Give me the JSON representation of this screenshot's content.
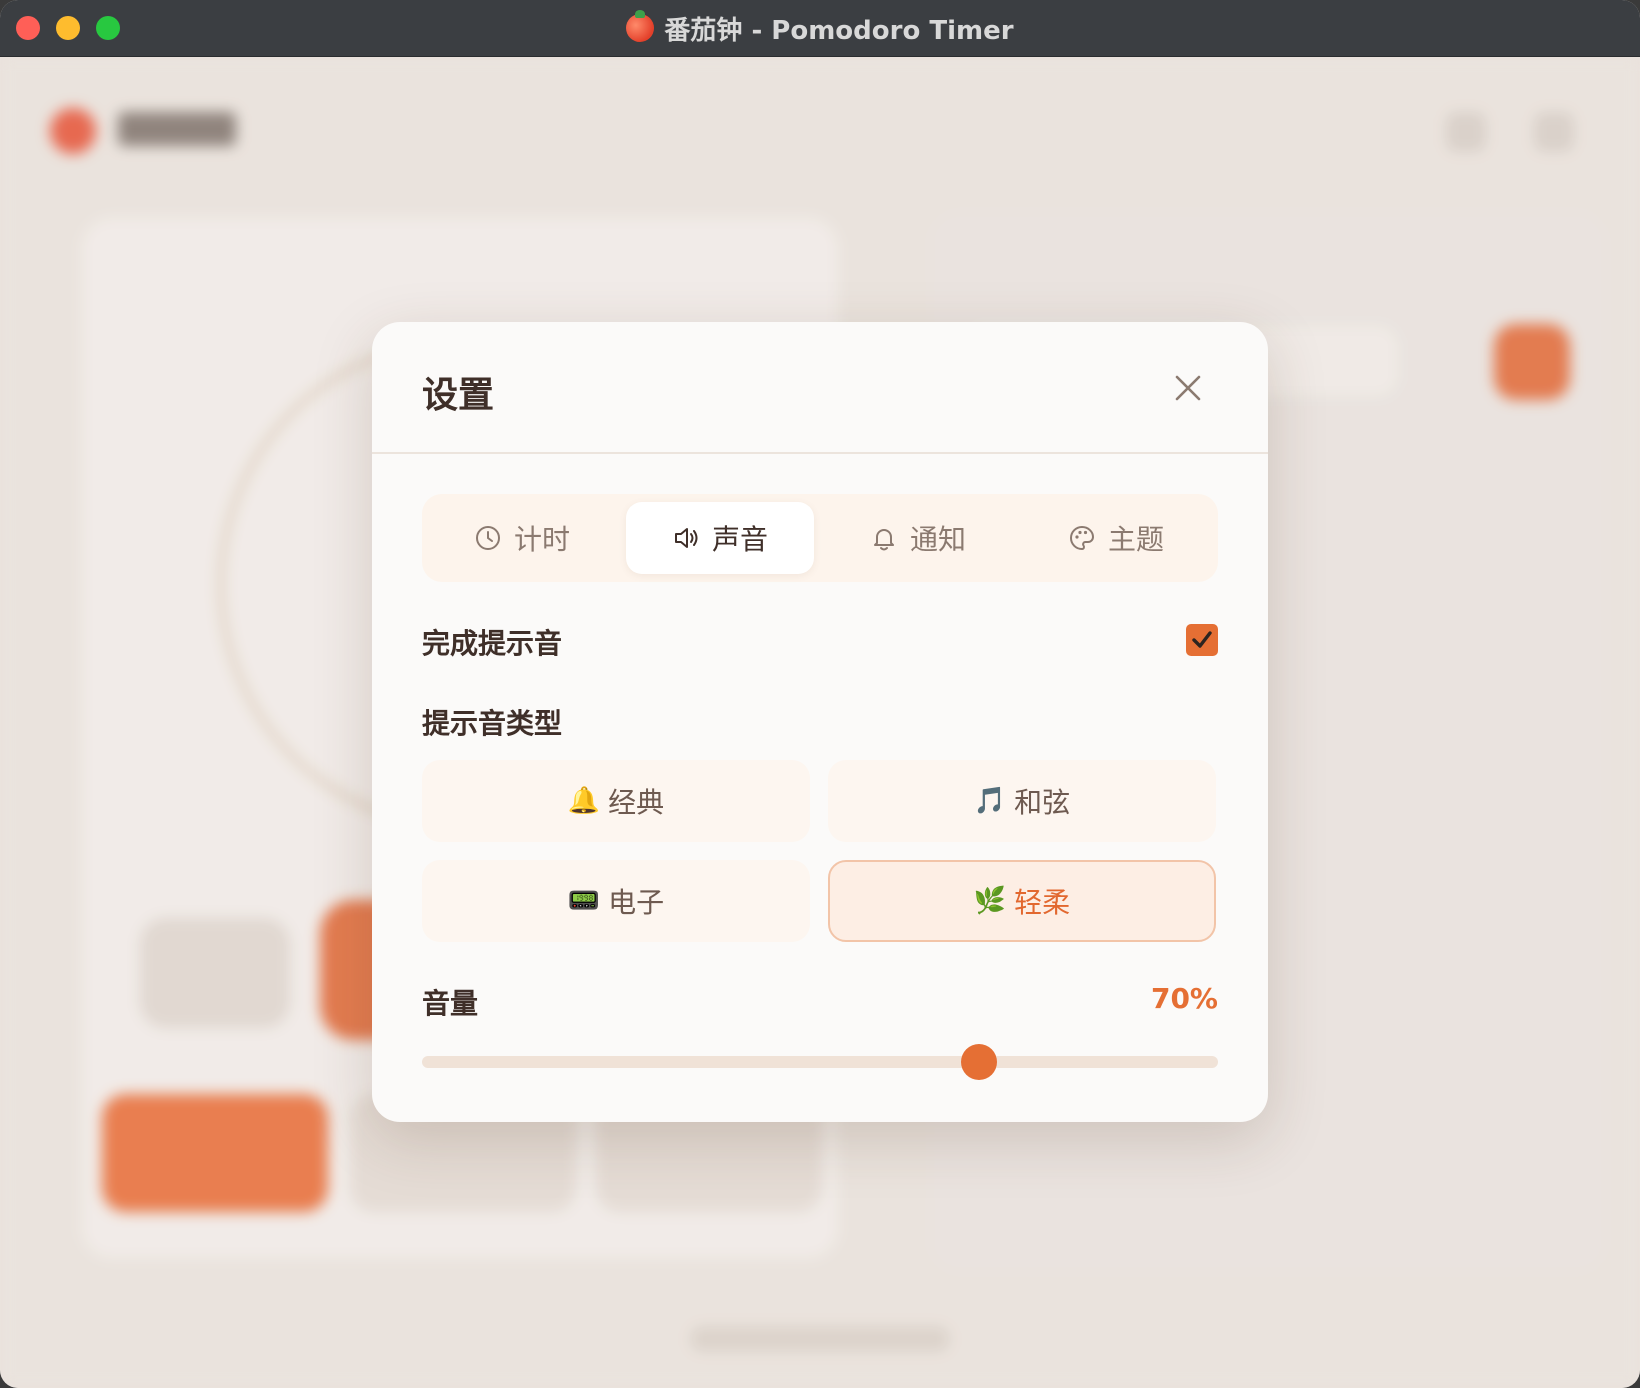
{
  "window": {
    "title": "番茄钟 - Pomodoro Timer"
  },
  "modal": {
    "title": "设置",
    "tabs": [
      {
        "label": "计时",
        "icon": "clock-icon",
        "active": false
      },
      {
        "label": "声音",
        "icon": "speaker-icon",
        "active": true
      },
      {
        "label": "通知",
        "icon": "bell-icon",
        "active": false
      },
      {
        "label": "主题",
        "icon": "palette-icon",
        "active": false
      }
    ],
    "completion_sound": {
      "label": "完成提示音",
      "checked": true
    },
    "sound_type": {
      "label": "提示音类型",
      "options": [
        {
          "emoji": "🔔",
          "label": "经典",
          "selected": false
        },
        {
          "emoji": "🎵",
          "label": "和弦",
          "selected": false
        },
        {
          "emoji": "📟",
          "label": "电子",
          "selected": false
        },
        {
          "emoji": "🌿",
          "label": "轻柔",
          "selected": true
        }
      ]
    },
    "volume": {
      "label": "音量",
      "value_text": "70%",
      "value": 0.7
    }
  },
  "colors": {
    "accent": "#e56f34",
    "text": "#3f2f29",
    "muted": "#8b7a70"
  }
}
